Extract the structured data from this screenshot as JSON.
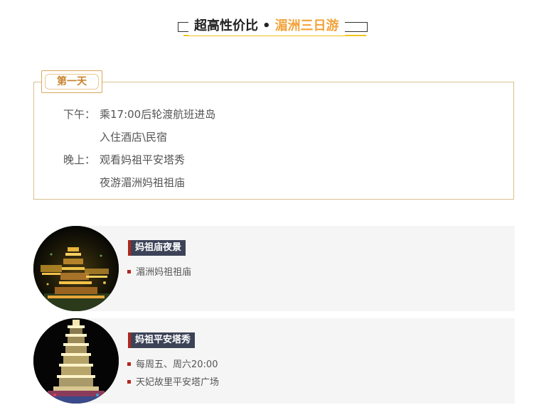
{
  "header": {
    "title": "超高性价比",
    "separator": "•",
    "subtitle": "湄洲三日游",
    "accent_color": "#f2a33a"
  },
  "day1": {
    "badge": "第一天",
    "rows": [
      {
        "label": "下午：",
        "text": "乘17:00后轮渡航班进岛"
      },
      {
        "label": "",
        "text": "入住酒店\\民宿"
      },
      {
        "label": "晚上：",
        "text": "观看妈祖平安塔秀"
      },
      {
        "label": "",
        "text": "夜游湄洲妈祖祖庙"
      }
    ]
  },
  "cards": [
    {
      "tag": "妈祖庙夜景",
      "items": [
        "湄洲妈祖祖庙"
      ],
      "image": "temple-night-photo"
    },
    {
      "tag": "妈祖平安塔秀",
      "items": [
        "每周五、周六20:00",
        "天妃故里平安塔广场"
      ],
      "image": "pagoda-night-photo"
    }
  ],
  "colors": {
    "tag_bg": "#3c4357",
    "tag_bar": "#b3261e",
    "badge_text": "#c8822e",
    "box_border": "#d9c090"
  }
}
